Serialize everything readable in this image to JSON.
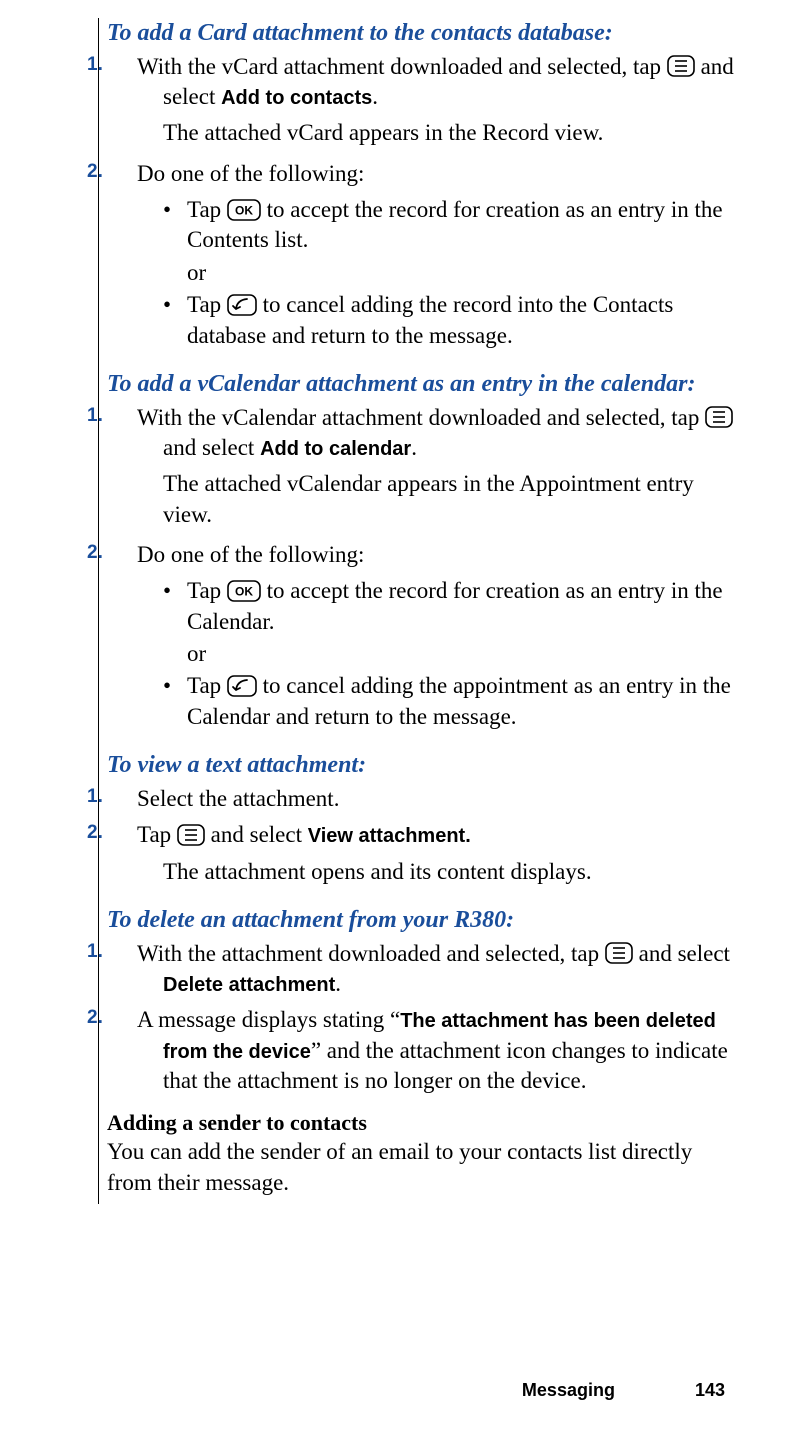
{
  "sections": [
    {
      "title": "To add a Card attachment to the contacts database:",
      "steps": [
        {
          "num": "1.",
          "pre": "With the vCard attachment downloaded and selected, tap ",
          "icon": "menu",
          "mid": " and select ",
          "bold": "Add to contacts",
          "post": ".",
          "result": "The attached vCard appears in the Record view."
        },
        {
          "num": "2.",
          "text": "Do one of the following:",
          "bullets": [
            {
              "pre": "Tap ",
              "icon": "ok",
              "post": " to accept the record for creation as an entry in the Contents list."
            },
            "or",
            {
              "pre": "Tap ",
              "icon": "back",
              "post": " to cancel adding the record into the Contacts database and return to the message."
            }
          ]
        }
      ]
    },
    {
      "title": "To add a vCalendar attachment as an entry in the calendar:",
      "steps": [
        {
          "num": "1.",
          "pre": "With the vCalendar attachment downloaded and selected, tap ",
          "icon": "menu",
          "mid": " and select ",
          "bold": "Add to calendar",
          "post": ".",
          "result": "The attached vCalendar appears in the Appointment entry view."
        },
        {
          "num": "2.",
          "text": "Do one of the following:",
          "bullets": [
            {
              "pre": "Tap ",
              "icon": "ok",
              "post": " to accept the record for creation as an entry in the Calendar."
            },
            "or",
            {
              "pre": "Tap ",
              "icon": "back",
              "post": " to cancel adding the appointment as an entry in the Calendar and return to the message."
            }
          ]
        }
      ]
    },
    {
      "title": "To view a text attachment:",
      "steps": [
        {
          "num": "1.",
          "text": "Select the attachment."
        },
        {
          "num": "2.",
          "pre": "Tap ",
          "icon": "menu",
          "mid": " and select ",
          "bold": "View attachment.",
          "post": "",
          "result": "The attachment opens and its content displays."
        }
      ]
    },
    {
      "title": "To delete an attachment from your R380:",
      "steps": [
        {
          "num": "1.",
          "pre": "With the attachment downloaded and selected, tap ",
          "icon": "menu",
          "mid": " and select ",
          "bold": "Delete attachment",
          "post": "."
        },
        {
          "num": "2.",
          "pre2": "A message displays stating “",
          "bold": "The attachment has been deleted from the device",
          "post": "” and the attachment icon changes to indicate that the attachment is no longer on the device."
        }
      ]
    }
  ],
  "subhead": "Adding a sender to contacts",
  "subbody": "You can add the sender of an email to your contacts list directly from their message.",
  "footer_label": "Messaging",
  "footer_page": "143"
}
